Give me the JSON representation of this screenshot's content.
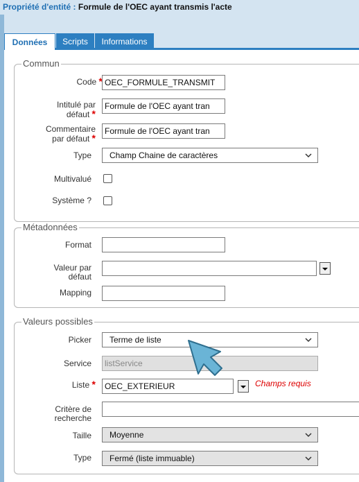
{
  "title": {
    "label": "Propriété d'entité :",
    "value": "Formule de l'OEC ayant transmis l'acte"
  },
  "tabs": [
    {
      "label": "Données",
      "active": true
    },
    {
      "label": "Scripts",
      "active": false
    },
    {
      "label": "Informations",
      "active": false
    }
  ],
  "commun": {
    "legend": "Commun",
    "code": {
      "label": "Code",
      "value": "OEC_FORMULE_TRANSMIT"
    },
    "intitule": {
      "label1": "Intitulé par",
      "label2": "défaut",
      "value": "Formule de l'OEC ayant tran"
    },
    "commentaire": {
      "label1": "Commentaire",
      "label2": "par défaut",
      "value": "Formule de l'OEC ayant tran"
    },
    "type": {
      "label": "Type",
      "value": "Champ Chaine de caractères"
    },
    "multivalue": {
      "label": "Multivalué"
    },
    "systeme": {
      "label": "Système ?"
    }
  },
  "metadonnees": {
    "legend": "Métadonnées",
    "format": {
      "label": "Format",
      "value": ""
    },
    "valeur": {
      "label1": "Valeur par",
      "label2": "défaut",
      "value": ""
    },
    "mapping": {
      "label": "Mapping",
      "value": ""
    }
  },
  "valeurs": {
    "legend": "Valeurs possibles",
    "picker": {
      "label": "Picker",
      "value": "Terme de liste"
    },
    "service": {
      "label": "Service",
      "value": "listService"
    },
    "liste": {
      "label": "Liste",
      "value": "OEC_EXTERIEUR",
      "required_msg": "Champs requis"
    },
    "critere": {
      "label1": "Critère de",
      "label2": "recherche",
      "value": ""
    },
    "taille": {
      "label": "Taille",
      "value": "Moyenne"
    },
    "type": {
      "label": "Type",
      "value": "Fermé (liste immuable)"
    }
  },
  "colors": {
    "accent": "#2d7fc1",
    "required": "#dd0000",
    "cursor": "#6ab4d6"
  }
}
